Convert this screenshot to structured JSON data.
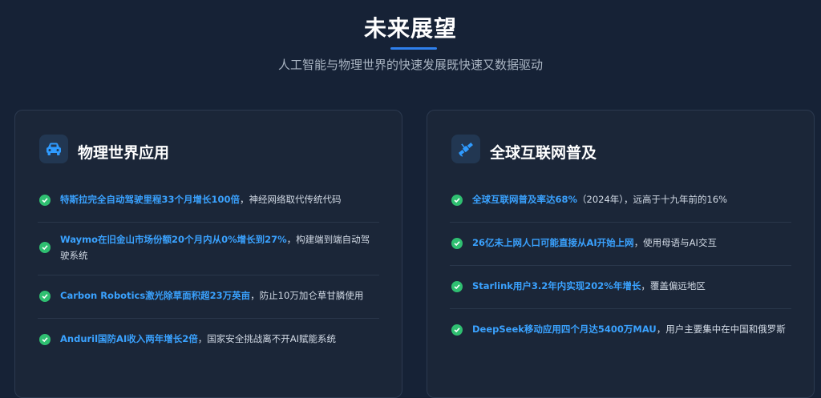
{
  "header": {
    "title": "未来展望",
    "subtitle": "人工智能与物理世界的快速发展既快速又数据驱动"
  },
  "colors": {
    "accent": "#2f80ed",
    "highlight": "#3aa2ff",
    "check": "#2fbf71"
  },
  "left_card": {
    "icon": "car-icon",
    "title": "物理世界应用",
    "items": [
      {
        "highlight": "特斯拉完全自动驾驶里程33个月增长100倍",
        "rest": "，神经网络取代传统代码"
      },
      {
        "highlight": "Waymo在旧金山市场份额20个月内从0%增长到27%",
        "rest": "，构建端到端自动驾驶系统"
      },
      {
        "highlight": "Carbon Robotics激光除草面积超23万英亩",
        "rest": "，防止10万加仑草甘膦使用"
      },
      {
        "highlight": "Anduril国防AI收入两年增长2倍",
        "rest": "，国家安全挑战离不开AI赋能系统"
      }
    ]
  },
  "right_card": {
    "icon": "satellite-icon",
    "title": "全球互联网普及",
    "items": [
      {
        "highlight": "全球互联网普及率达68%",
        "rest": "（2024年），远高于十九年前的16%"
      },
      {
        "highlight": "26亿未上网人口可能直接从AI开始上网",
        "rest": "，使用母语与AI交互"
      },
      {
        "highlight": "Starlink用户3.2年内实现202%年增长",
        "rest": "，覆盖偏远地区"
      },
      {
        "highlight": "DeepSeek移动应用四个月达5400万MAU",
        "rest": "，用户主要集中在中国和俄罗斯"
      }
    ]
  }
}
